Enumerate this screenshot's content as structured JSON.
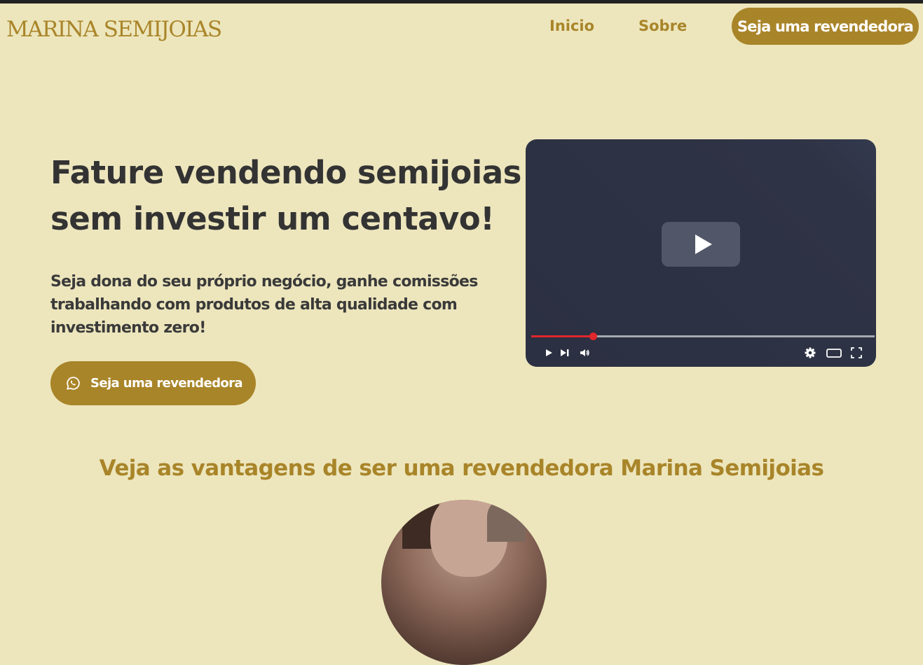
{
  "brand": {
    "logo_text": "MARINA SEMIJOIAS"
  },
  "nav": {
    "links": [
      "Inicio",
      "Sobre"
    ],
    "cta_label": "Seja uma revendedora"
  },
  "hero": {
    "title": "Fature vendendo semijoias sem investir um centavo!",
    "subtitle": "Seja dona do seu próprio negócio, ganhe comissões trabalhando com produtos de alta qualidade com investimento zero!",
    "cta_label": "Seja uma revendedora",
    "cta_icon": "whatsapp-icon"
  },
  "video": {
    "progress_fraction": 0.18,
    "controls": [
      "play-icon",
      "next-icon",
      "volume-icon",
      "settings-icon",
      "theater-mode-icon",
      "fullscreen-icon"
    ]
  },
  "section": {
    "title": "Veja as vantagens de ser uma revendedora Marina Semijoias"
  },
  "colors": {
    "background": "#ede6bd",
    "accent": "#a98529",
    "text": "#333333",
    "video_bg": "#2b3042",
    "progress": "#e0272b"
  }
}
